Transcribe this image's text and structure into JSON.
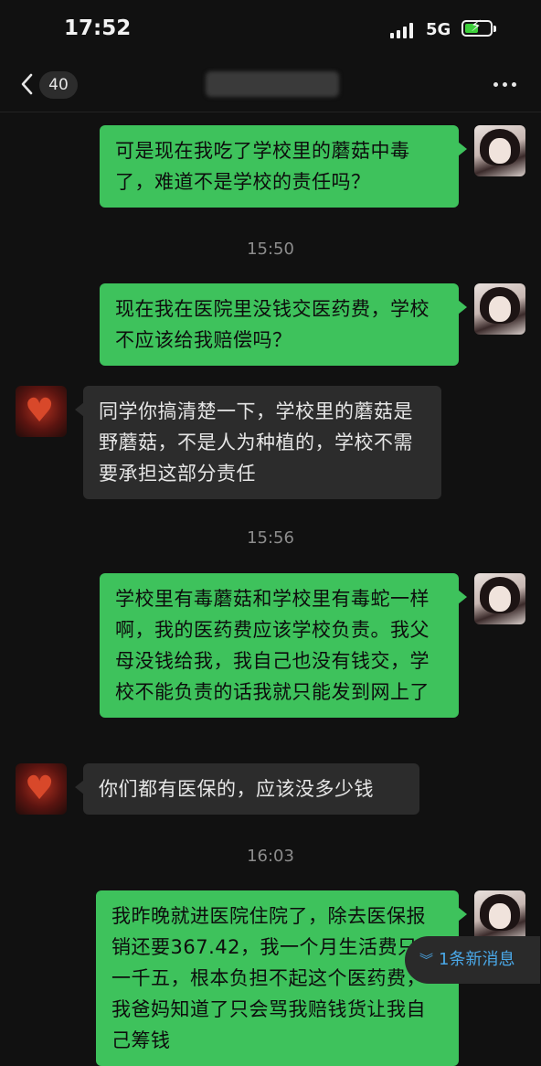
{
  "status": {
    "time": "17:52",
    "network": "5G",
    "battery_level": 0.45
  },
  "header": {
    "unread_count": "40",
    "more_label": "..."
  },
  "messages": [
    {
      "side": "sent",
      "text": "可是现在我吃了学校里的蘑菇中毒了，难道不是学校的责任吗？"
    },
    {
      "type": "time",
      "text": "15:50"
    },
    {
      "side": "sent",
      "text": "现在我在医院里没钱交医药费，学校不应该给我赔偿吗？"
    },
    {
      "side": "recv",
      "text": "同学你搞清楚一下，学校里的蘑菇是野蘑菇，不是人为种植的，学校不需要承担这部分责任"
    },
    {
      "type": "time",
      "text": "15:56"
    },
    {
      "side": "sent",
      "text": "学校里有毒蘑菇和学校里有毒蛇一样啊，我的医药费应该学校负责。我父母没钱给我，我自己也没有钱交，学校不能负责的话我就只能发到网上了"
    },
    {
      "side": "recv",
      "text": "你们都有医保的，应该没多少钱"
    },
    {
      "type": "time",
      "text": "16:03"
    },
    {
      "side": "sent",
      "text": "我昨晚就进医院住院了，除去医保报销还要367.42，我一个月生活费只有一千五，根本负担不起这个医药费，我爸妈知道了只会骂我赔钱货让我自己筹钱"
    }
  ],
  "new_message_pill": {
    "label": "1条新消息",
    "icon": "double-chevron-down-icon"
  },
  "colors": {
    "sent_bubble": "#3ec25c",
    "recv_bubble": "#2c2c2c",
    "background": "#111111",
    "link": "#4aa8e8"
  }
}
